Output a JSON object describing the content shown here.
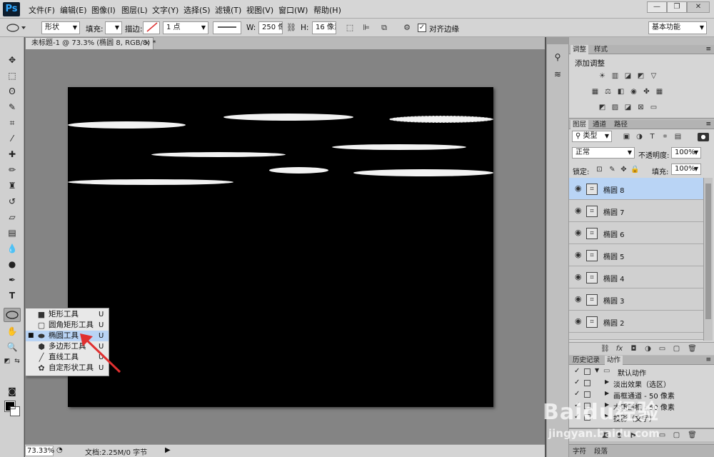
{
  "app": {
    "logo": "Ps"
  },
  "menubar": {
    "items": [
      "文件(F)",
      "编辑(E)",
      "图像(I)",
      "图层(L)",
      "文字(Y)",
      "选择(S)",
      "滤镜(T)",
      "视图(V)",
      "窗口(W)",
      "帮助(H)"
    ],
    "minimize": "—",
    "restore": "❐",
    "close": "✕"
  },
  "options": {
    "mode": "形状",
    "fill_label": "填充:",
    "stroke_label": "描边:",
    "stroke_width": "1 点",
    "w_label": "W:",
    "w_value": "250 像素",
    "h_label": "H:",
    "h_value": "16 像素",
    "align_edges_label": "对齐边缘",
    "workspace": "基本功能"
  },
  "document": {
    "tab_title": "未标题-1 @ 73.3% (椭圆 8, RGB/8) *",
    "tab_close": "×",
    "background_color": "#000000",
    "shape_color": "#f2f2f2"
  },
  "status": {
    "zoom": "73.33%",
    "doc_info": "文档:2.25M/0 字节",
    "arrow": "▶"
  },
  "tool_flyout": {
    "items": [
      {
        "label": "矩形工具",
        "key": "U",
        "icon": "rectangle-icon",
        "selected": false
      },
      {
        "label": "圆角矩形工具",
        "key": "U",
        "icon": "rounded-rectangle-icon",
        "selected": false
      },
      {
        "label": "椭圆工具",
        "key": "U",
        "icon": "ellipse-icon",
        "selected": true
      },
      {
        "label": "多边形工具",
        "key": "U",
        "icon": "polygon-icon",
        "selected": false
      },
      {
        "label": "直线工具",
        "key": "U",
        "icon": "line-icon",
        "selected": false
      },
      {
        "label": "自定形状工具",
        "key": "U",
        "icon": "custom-shape-icon",
        "selected": false
      }
    ],
    "annotation_color": "#e03030"
  },
  "adjustments_panel": {
    "tabs": [
      "调整",
      "样式"
    ],
    "title": "添加调整"
  },
  "layers_panel": {
    "tabs": [
      "图层",
      "通道",
      "路径"
    ],
    "filter_label": "类型",
    "blend_mode": "正常",
    "opacity_label": "不透明度:",
    "opacity_value": "100%",
    "lock_label": "锁定:",
    "fill_label": "填充:",
    "fill_value": "100%",
    "layers": [
      {
        "name": "椭圆 8",
        "selected": true
      },
      {
        "name": "椭圆 7",
        "selected": false
      },
      {
        "name": "椭圆 6",
        "selected": false
      },
      {
        "name": "椭圆 5",
        "selected": false
      },
      {
        "name": "椭圆 4",
        "selected": false
      },
      {
        "name": "椭圆 3",
        "selected": false
      },
      {
        "name": "椭圆 2",
        "selected": false
      }
    ],
    "selected_color": "#b9d4f5"
  },
  "actions_panel": {
    "tabs": [
      "历史记录",
      "动作"
    ],
    "rows": [
      {
        "label": "默认动作",
        "level": 0
      },
      {
        "label": "淡出效果（选区）",
        "level": 1
      },
      {
        "label": "画框通道 - 50 像素",
        "level": 1
      },
      {
        "label": "木质画框 - 50 像素",
        "level": 1
      },
      {
        "label": "投影（文字）",
        "level": 1
      }
    ]
  },
  "bottom_panel": {
    "tabs": [
      "字符",
      "段落"
    ]
  },
  "watermark": {
    "main": "Baidu经验",
    "sub": "jingyan.baidu.com"
  }
}
